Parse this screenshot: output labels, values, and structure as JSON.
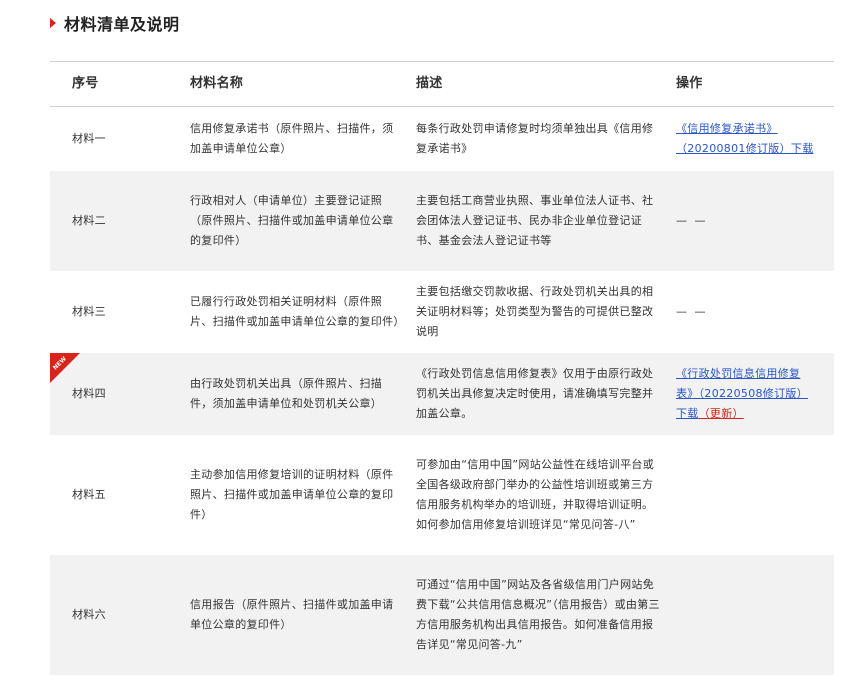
{
  "section": {
    "title": "材料清单及说明"
  },
  "table": {
    "headers": [
      "序号",
      "材料名称",
      "描述",
      "操作"
    ],
    "rows": [
      {
        "no": "材料一",
        "name": "信用修复承诺书（原件照片、扫描件，须加盖申请单位公章）",
        "desc": "每条行政处罚申请修复时均须单独出具《信用修复承诺书》",
        "action_link": "《信用修复承诺书》（20200801修订版）下载",
        "action_extra": ""
      },
      {
        "no": "材料二",
        "name": "行政相对人（申请单位）主要登记证照（原件照片、扫描件或加盖申请单位公章的复印件）",
        "desc": "主要包括工商营业执照、事业单位法人证书、社会团体法人登记证书、民办非企业单位登记证书、基金会法人登记证书等",
        "action_text": "— —"
      },
      {
        "no": "材料三",
        "name": "已履行行政处罚相关证明材料（原件照片、扫描件或加盖申请单位公章的复印件）",
        "desc": "主要包括缴交罚款收据、行政处罚机关出具的相关证明材料等；处罚类型为警告的可提供已整改说明",
        "action_text": "— —"
      },
      {
        "no": "材料四",
        "badge": "NEW",
        "name": "由行政处罚机关出具（原件照片、扫描件，须加盖申请单位和处罚机关公章）",
        "desc": "《行政处罚信息信用修复表》仅用于由原行政处罚机关出具修复决定时使用，请准确填写完整并加盖公章。",
        "action_link": "《行政处罚信息信用修复表》（20220508修订版）下载",
        "action_extra": "（更新）"
      },
      {
        "no": "材料五",
        "name": "主动参加信用修复培训的证明材料（原件照片、扫描件或加盖申请单位公章的复印件）",
        "desc": "可参加由“信用中国”网站公益性在线培训平台或全国各级政府部门举办的公益性培训班或第三方信用服务机构举办的培训班，并取得培训证明。如何参加信用修复培训班详见“常见问答-八”",
        "action_text": ""
      },
      {
        "no": "材料六",
        "name": "信用报告（原件照片、扫描件或加盖申请单位公章的复印件）",
        "desc": "可通过“信用中国”网站及各省级信用门户网站免费下载“公共信用信息概况”（信用报告）或由第三方信用服务机构出具信用报告。如何准备信用报告详见“常见问答-九”",
        "action_text": ""
      }
    ]
  },
  "colors": {
    "accent": "#d9241b",
    "link": "#2a56c6",
    "row_gray": "#f2f2f2"
  }
}
